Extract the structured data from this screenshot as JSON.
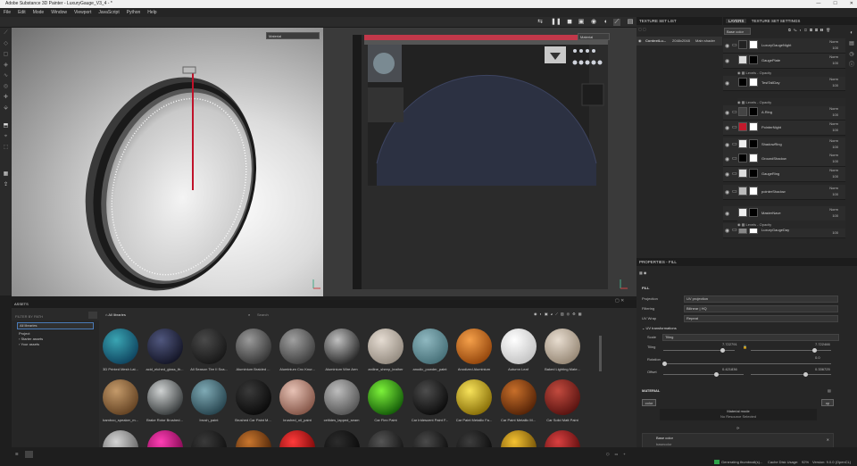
{
  "window": {
    "title": "Adobe Substance 3D Painter - LuxuryGauge_V3_4 - *"
  },
  "menu": [
    "File",
    "Edit",
    "Mode",
    "Window",
    "Viewport",
    "JavaScript",
    "Python",
    "Help"
  ],
  "viewport3d": {
    "material_dropdown": "Material"
  },
  "viewport2d": {
    "material_dropdown": "Material"
  },
  "texture_set_list": {
    "tab": "TEXTURE SET LIST",
    "row_name": "ContextLu...",
    "row_res": "2048x2048",
    "row_shader": "Main shader"
  },
  "layers": {
    "tab_layers": "LAYERS",
    "tab_settings": "TEXTURE SET SETTINGS",
    "channel": "Base color",
    "rows": [
      {
        "name": "LuxuryGaugeNight",
        "blend": "Norm",
        "op": "100",
        "kind": "folder"
      },
      {
        "name": "GaugePlate",
        "blend": "Norm",
        "op": "100",
        "kind": "layer"
      },
      {
        "name": "TestTallDay",
        "blend": "Norm",
        "op": "100",
        "kind": "layer"
      },
      {
        "name": "A.Ring",
        "blend": "Norm",
        "op": "100",
        "kind": "folder"
      },
      {
        "name": "PointerNight",
        "blend": "Norm",
        "op": "100",
        "kind": "folder"
      },
      {
        "name": "ShadowRing",
        "blend": "Norm",
        "op": "100",
        "kind": "folder"
      },
      {
        "name": "GroundShadow",
        "blend": "Norm",
        "op": "100",
        "kind": "folder"
      },
      {
        "name": "GaugeRing",
        "blend": "Norm",
        "op": "100",
        "kind": "folder"
      },
      {
        "name": "pointerShadow",
        "blend": "Norm",
        "op": "100",
        "kind": "folder"
      },
      {
        "name": "MasterNave",
        "blend": "Norm",
        "op": "100",
        "kind": "layer"
      },
      {
        "name": "LuxuryGaugeDay",
        "blend": "Norm",
        "op": "100",
        "kind": "folder"
      }
    ],
    "sub_levels": "Levels - Opacity"
  },
  "properties": {
    "title": "PROPERTIES - FILL",
    "fill_header": "FILL",
    "projection_label": "Projection",
    "projection_value": "UV projection",
    "filtering_label": "Filtering",
    "filtering_value": "Bilinear | HQ",
    "uvwrap_label": "UV Wrap",
    "uvwrap_value": "Repeat",
    "uvtrans_header": "UV transformations",
    "scale_label": "Scale",
    "scale_value": "Tiling",
    "tiling_label": "Tiling",
    "tiling_a": "7.722791",
    "tiling_b": "7.722466",
    "rotation_label": "Rotation",
    "rotation_value": "0.0",
    "offset_label": "Offset",
    "offset_a": "0.421836",
    "offset_b": "0.336725",
    "material_header": "MATERIAL",
    "color_btn": "color",
    "op_btn": "op",
    "material_mode": "Material mode",
    "no_resource": "No Resource Selected",
    "base_color": "Base color",
    "base_color_sub": "basecolor",
    "opacity": "Opacity"
  },
  "assets": {
    "title": "ASSETS",
    "filter_label": "FILTER BY PATH",
    "tree": [
      "All libraries",
      "Project",
      "Starter assets",
      "Your assets"
    ],
    "breadcrumb": "All libraries",
    "search_placeholder": "Search",
    "swatches": [
      {
        "name": "3D Printed Mesh Lat...",
        "c1": "#3aa5b3",
        "c2": "#0b3b57"
      },
      {
        "name": "acid_etched_glass_th...",
        "c1": "#50577e",
        "c2": "#0e0f1e"
      },
      {
        "name": "All Season Tire II Sca...",
        "c1": "#4a4a4a",
        "c2": "#121212"
      },
      {
        "name": "Aluminium Braided ...",
        "c1": "#9a9a9a",
        "c2": "#2c2c2c"
      },
      {
        "name": "Aluminium Cnc Knur...",
        "c1": "#a0a0a0",
        "c2": "#353535"
      },
      {
        "name": "Aluminium Wire Arm",
        "c1": "#c0c0c0",
        "c2": "#1a1a1a"
      },
      {
        "name": "aniline_sheep_leather",
        "c1": "#e5dcd2",
        "c2": "#8c8378"
      },
      {
        "name": "anodic_powder_paint",
        "c1": "#8fb8c0",
        "c2": "#3f6870"
      },
      {
        "name": "Anodized Aluminium",
        "c1": "#f5a04a",
        "c2": "#8a3d06"
      },
      {
        "name": "Autumn Leaf",
        "c1": "#ffffff",
        "c2": "#bdbdbd"
      },
      {
        "name": "Baked Lighting Mate...",
        "c1": "#e8ddd0",
        "c2": "#8e7f6c"
      },
      {
        "name": "bamboo_speaker_m...",
        "c1": "#c49a6a",
        "c2": "#5a3a1c"
      },
      {
        "name": "Brake Rotor Brushed...",
        "c1": "#cfd2d2",
        "c2": "#2a2e2f"
      },
      {
        "name": "brush_paint",
        "c1": "#7faab5",
        "c2": "#1e3a44"
      },
      {
        "name": "Brushed Car Paint M...",
        "c1": "#3a3a3a",
        "c2": "#050505"
      },
      {
        "name": "brushed_oil_paint",
        "c1": "#e7c2b5",
        "c2": "#7a4a3c"
      },
      {
        "name": "celtides_lapped_seam",
        "c1": "#bdbdbd",
        "c2": "#4a4a4a"
      },
      {
        "name": "Car Flex Paint",
        "c1": "#7df23a",
        "c2": "#0a4d04"
      },
      {
        "name": "Car Iridescent Paint F...",
        "c1": "#4d4d4d",
        "c2": "#050505"
      },
      {
        "name": "Car Paint Metallic Fa...",
        "c1": "#f7e25a",
        "c2": "#7d6300"
      },
      {
        "name": "Car Paint Metallic M...",
        "c1": "#c86f2a",
        "c2": "#4a1c04"
      },
      {
        "name": "Car Solid Matt Paint",
        "c1": "#c24a3e",
        "c2": "#4e0e0c"
      },
      {
        "name": "",
        "c1": "#d4d4d4",
        "c2": "#555555"
      },
      {
        "name": "",
        "c1": "#ff3fb5",
        "c2": "#6e0041"
      },
      {
        "name": "",
        "c1": "#3a3a3a",
        "c2": "#0a0a0a"
      },
      {
        "name": "",
        "c1": "#c8762e",
        "c2": "#3d1a04"
      },
      {
        "name": "",
        "c1": "#ff3b3b",
        "c2": "#650000"
      },
      {
        "name": "",
        "c1": "#2c2c2c",
        "c2": "#050505"
      },
      {
        "name": "",
        "c1": "#555555",
        "c2": "#0a0a0a"
      },
      {
        "name": "",
        "c1": "#4a4a4a",
        "c2": "#050505"
      },
      {
        "name": "",
        "c1": "#3d3d3d",
        "c2": "#050505"
      },
      {
        "name": "",
        "c1": "#f5c232",
        "c2": "#5c3e00"
      },
      {
        "name": "",
        "c1": "#d94040",
        "c2": "#4a0606"
      }
    ]
  },
  "status": {
    "computing": "Generating thumbnail(s)...",
    "cache": "Cache Disk Usage:",
    "cache_pct": "92%",
    "version": "Version: 9.0.0 (OpenCL)"
  }
}
